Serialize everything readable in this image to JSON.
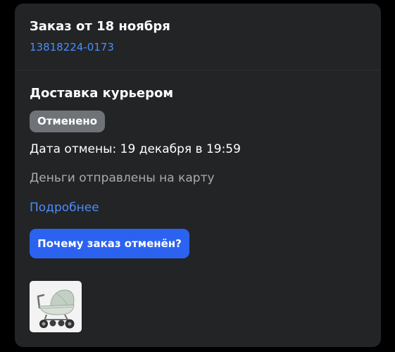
{
  "order": {
    "title": "Заказ от 18 ноября",
    "number": "13818224-0173"
  },
  "delivery": {
    "title": "Доставка курьером",
    "status": "Отменено",
    "cancel_date": "Дата отмены: 19 декабря в 19:59",
    "refund": "Деньги отправлены на карту",
    "details_link": "Подробнее",
    "why_button": "Почему заказ отменён?"
  },
  "product": {
    "image_icon": "baby-stroller"
  },
  "colors": {
    "background": "#000000",
    "card": "#232426",
    "accent_link": "#4b8df8",
    "primary_button": "#2b63f0",
    "status_badge": "#6f7276",
    "secondary_text": "#a9abb0"
  }
}
